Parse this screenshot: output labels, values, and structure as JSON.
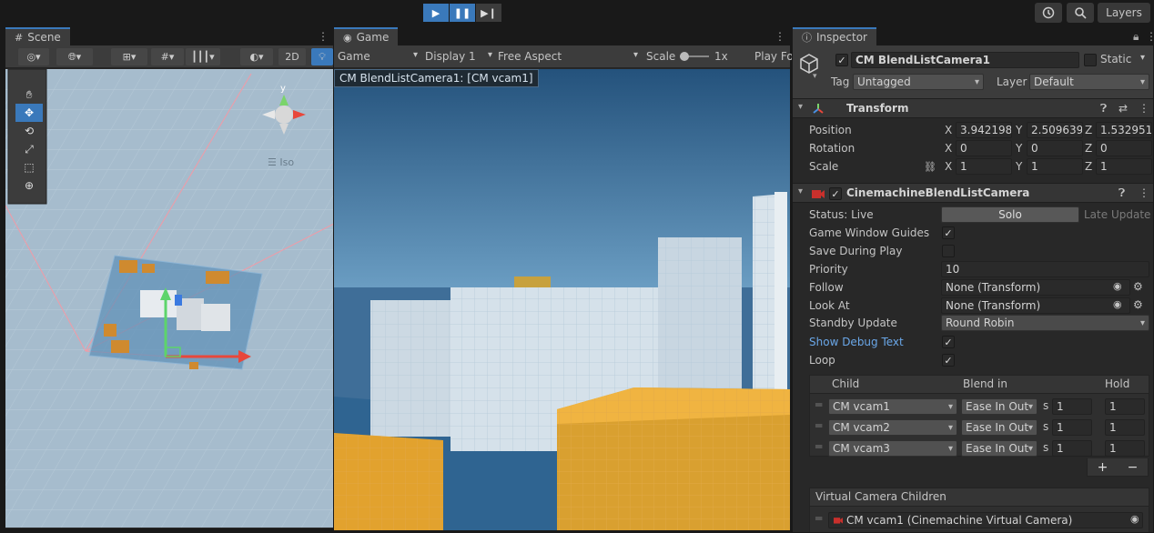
{
  "toolbar": {
    "play_icon": "play-icon",
    "pause_icon": "pause-icon",
    "step_icon": "step-icon",
    "history_icon": "history-icon",
    "search_icon": "search-icon",
    "layers_label": "Layers"
  },
  "scene": {
    "tab_label": "Scene",
    "btn_2d": "2D",
    "iso_label": "Iso",
    "gizmo_axis": "y"
  },
  "game": {
    "tab_label": "Game",
    "mode": "Game",
    "display": "Display 1",
    "aspect": "Free Aspect",
    "scale_label": "Scale",
    "scale_value": "1x",
    "play_focused": "Play Fo",
    "camera_label": "CM BlendListCamera1: [CM vcam1]"
  },
  "inspector": {
    "tab_label": "Inspector",
    "object_name": "CM BlendListCamera1",
    "static_label": "Static",
    "tag_label": "Tag",
    "tag_value": "Untagged",
    "layer_label": "Layer",
    "layer_value": "Default",
    "transform": {
      "title": "Transform",
      "position_label": "Position",
      "rotation_label": "Rotation",
      "scale_label": "Scale",
      "pos_x": "3.942198",
      "pos_y": "2.509639",
      "pos_z": "1.532951",
      "rot_x": "0",
      "rot_y": "0",
      "rot_z": "0",
      "scl_x": "1",
      "scl_y": "1",
      "scl_z": "1",
      "x": "X",
      "y": "Y",
      "z": "Z"
    },
    "blendlist": {
      "title": "CinemachineBlendListCamera",
      "status_label": "Status: Live",
      "solo_label": "Solo",
      "late_update_label": "Late Update",
      "game_window_guides_label": "Game Window Guides",
      "save_during_play_label": "Save During Play",
      "priority_label": "Priority",
      "priority_value": "10",
      "follow_label": "Follow",
      "follow_value": "None (Transform)",
      "look_at_label": "Look At",
      "look_at_value": "None (Transform)",
      "standby_label": "Standby Update",
      "standby_value": "Round Robin",
      "show_debug_label": "Show Debug Text",
      "loop_label": "Loop",
      "col_child": "Child",
      "col_blend_in": "Blend in",
      "col_hold": "Hold",
      "rows": [
        {
          "child": "CM vcam1",
          "blend": "Ease In Out",
          "s": "s",
          "time": "1",
          "hold": "1"
        },
        {
          "child": "CM vcam2",
          "blend": "Ease In Out",
          "s": "s",
          "time": "1",
          "hold": "1"
        },
        {
          "child": "CM vcam3",
          "blend": "Ease In Out",
          "s": "s",
          "time": "1",
          "hold": "1"
        }
      ],
      "add_label": "+",
      "remove_label": "−",
      "vc_children_label": "Virtual Camera Children",
      "vc_child_item": "CM vcam1 (Cinemachine Virtual Camera)"
    }
  }
}
